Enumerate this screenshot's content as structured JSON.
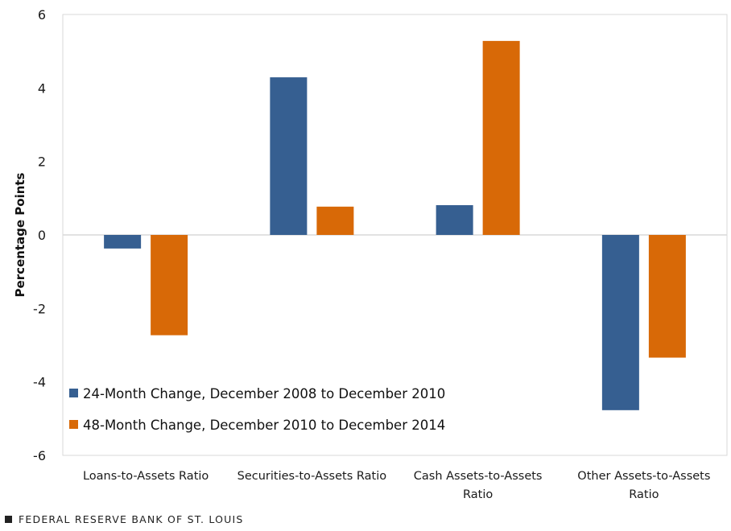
{
  "chart_data": {
    "type": "bar",
    "title": "",
    "xlabel": "",
    "ylabel": "Percentage Points",
    "ylim": [
      -6,
      6
    ],
    "yticks": [
      6,
      4,
      2,
      0,
      -2,
      -4,
      -6
    ],
    "grid": false,
    "legend_position": "bottom-left (inside plot)",
    "categories": [
      [
        "Loans-to-Assets Ratio"
      ],
      [
        "Securities-to-Assets Ratio"
      ],
      [
        "Cash Assets-to-Assets",
        "Ratio"
      ],
      [
        "Other Assets-to-Assets",
        "Ratio"
      ]
    ],
    "series": [
      {
        "name": "24-Month Change, December 2008 to December 2010",
        "color": "#365f91",
        "values": [
          -0.37,
          4.29,
          0.81,
          -4.77
        ]
      },
      {
        "name": "48-Month Change, December 2010 to December 2014",
        "color": "#d86907",
        "values": [
          -2.73,
          0.77,
          5.28,
          -3.34
        ]
      }
    ]
  },
  "footer": {
    "source": "FEDERAL RESERVE BANK OF ST. LOUIS"
  }
}
